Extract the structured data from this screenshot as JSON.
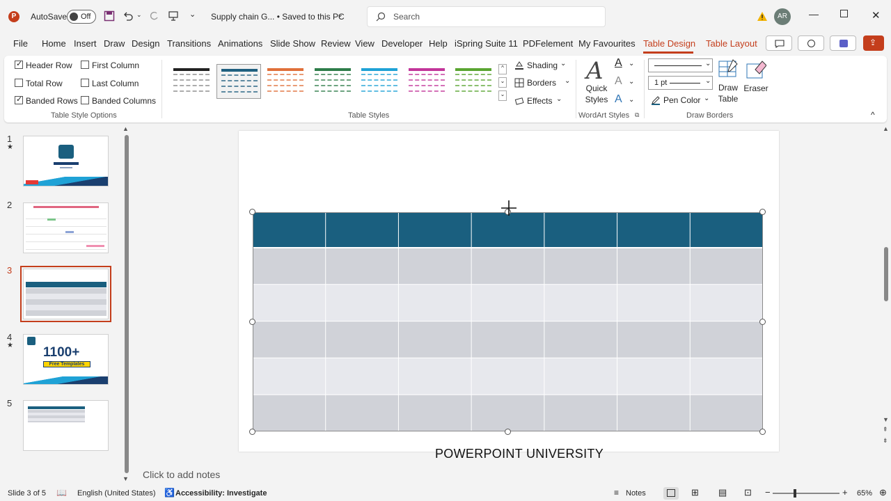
{
  "titlebar": {
    "autosave_label": "AutoSave",
    "autosave_state": "Off",
    "document_title": "Supply chain G... • Saved to this PC",
    "search_placeholder": "Search",
    "user_initials": "AR"
  },
  "menu_tabs": [
    "File",
    "Home",
    "Insert",
    "Draw",
    "Design",
    "Transitions",
    "Animations",
    "Slide Show",
    "Review",
    "View",
    "Developer",
    "Help",
    "iSpring Suite 11",
    "PDFelement",
    "My Favourites",
    "Table Design",
    "Table Layout"
  ],
  "active_tab": "Table Design",
  "ribbon": {
    "table_style_options": {
      "group_label": "Table Style Options",
      "options": [
        {
          "label": "Header Row",
          "checked": true
        },
        {
          "label": "First Column",
          "checked": false
        },
        {
          "label": "Total Row",
          "checked": false
        },
        {
          "label": "Last Column",
          "checked": false
        },
        {
          "label": "Banded Rows",
          "checked": true
        },
        {
          "label": "Banded Columns",
          "checked": false
        }
      ]
    },
    "table_styles": {
      "group_label": "Table Styles",
      "shading": "Shading",
      "borders": "Borders",
      "effects": "Effects",
      "swatches": [
        "#222222",
        "#1f5f7f",
        "#e0703a",
        "#2e7d4a",
        "#1fa2d6",
        "#c2359a",
        "#5aa531"
      ]
    },
    "wordart": {
      "group_label": "WordArt Styles",
      "quick_styles": "Quick Styles"
    },
    "draw_borders": {
      "group_label": "Draw Borders",
      "pen_weight": "1 pt",
      "pen_color": "Pen Color",
      "draw_table": "Draw Table",
      "eraser": "Eraser"
    }
  },
  "slides": [
    {
      "number": "1",
      "starred": true
    },
    {
      "number": "2",
      "starred": false
    },
    {
      "number": "3",
      "starred": false,
      "selected": true
    },
    {
      "number": "4",
      "starred": true,
      "thumb_text": "1100+",
      "thumb_sub": "Free Templates"
    },
    {
      "number": "5",
      "starred": false
    }
  ],
  "slide": {
    "table": {
      "columns": 7,
      "rows": 6,
      "header_color": "#1a5f7f",
      "band_dark": "#d0d2d8",
      "band_light": "#e7e8ed"
    },
    "footer": "POWERPOINT UNIVERSITY"
  },
  "notes_placeholder": "Click to add notes",
  "status": {
    "slide_counter": "Slide 3 of 5",
    "language": "English (United States)",
    "accessibility": "Accessibility: Investigate",
    "notes": "Notes",
    "zoom": "65%"
  },
  "colors": {
    "accent": "#c43e1c",
    "table_header": "#1a5f7f"
  }
}
